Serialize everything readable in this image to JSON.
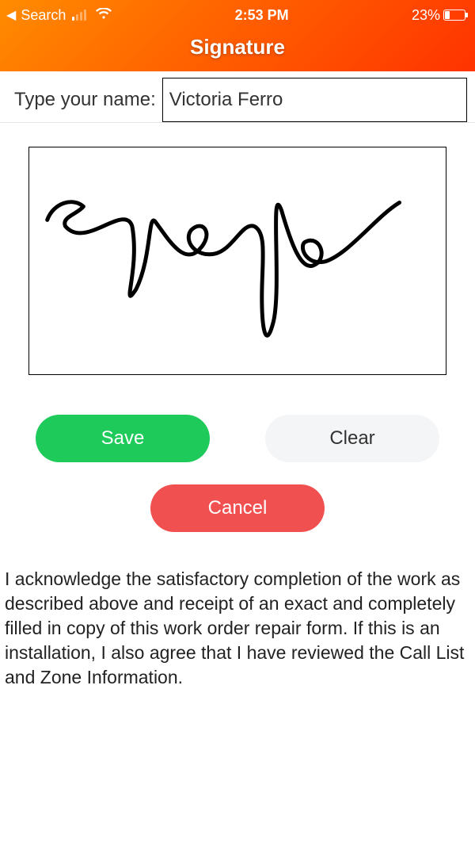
{
  "status_bar": {
    "back_label": "Search",
    "time": "2:53 PM",
    "battery_percent": "23%"
  },
  "header": {
    "title": "Signature"
  },
  "name_field": {
    "label": "Type your name:",
    "value": "Victoria Ferro"
  },
  "buttons": {
    "save": "Save",
    "clear": "Clear",
    "cancel": "Cancel"
  },
  "disclosure": "I acknowledge the satisfactory completion of the work as described above and receipt of an exact and completely filled in copy of this work order repair form. If this is an installation, I also agree that I have reviewed the Call List and Zone Information."
}
